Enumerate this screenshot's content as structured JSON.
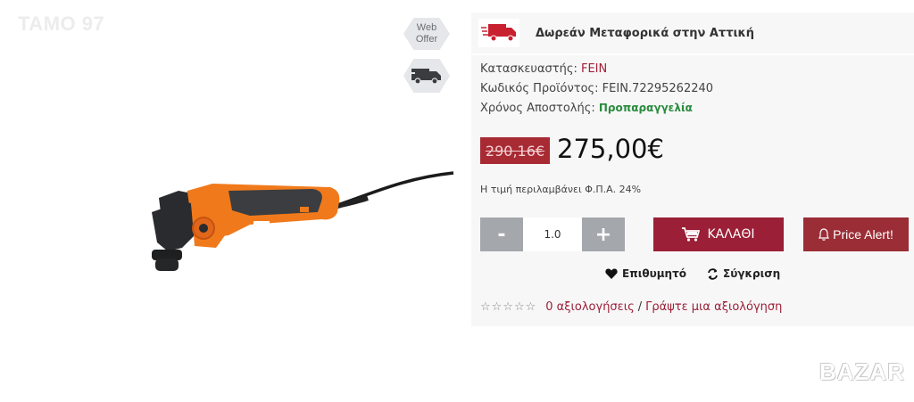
{
  "watermark": {
    "top_left": "TAMO 97",
    "bottom_right": "BAZAR"
  },
  "badges": {
    "web_offer_line1": "Web",
    "web_offer_line2": "Offer",
    "truck_icon": "truck-icon"
  },
  "shipping": {
    "text": "Δωρεάν Μεταφορικά στην Αττική",
    "icon": "delivery-truck-icon"
  },
  "product": {
    "manufacturer_label": "Κατασκευαστής:",
    "manufacturer_value": "FEIN",
    "code_label": "Κωδικός Προϊόντος:",
    "code_value": "FEIN.72295262240",
    "shipping_time_label": "Χρόνος Αποστολής:",
    "shipping_time_value": "Προπαραγγελία"
  },
  "price": {
    "old": "290,16€",
    "new": "275,00€",
    "vat_note": "Η τιμή περιλαμβάνει Φ.Π.Α. 24%"
  },
  "quantity": {
    "minus": "-",
    "value": "1.0",
    "plus": "+"
  },
  "actions": {
    "cart_label": "ΚΑΛΑΘΙ",
    "price_alert_label": "Price Alert!",
    "wishlist_label": "Επιθυμητό",
    "compare_label": "Σύγκριση"
  },
  "rating": {
    "stars": "☆☆☆☆☆",
    "reviews_link": "0 αξιολογήσεις",
    "separator": "/",
    "write_link": "Γράψτε μια αξιολόγηση"
  },
  "colors": {
    "accent": "#9b1f36",
    "old_price_bg": "#a82b34",
    "stock_green": "#2a8b3c",
    "button_gray": "#a4a7ab"
  }
}
